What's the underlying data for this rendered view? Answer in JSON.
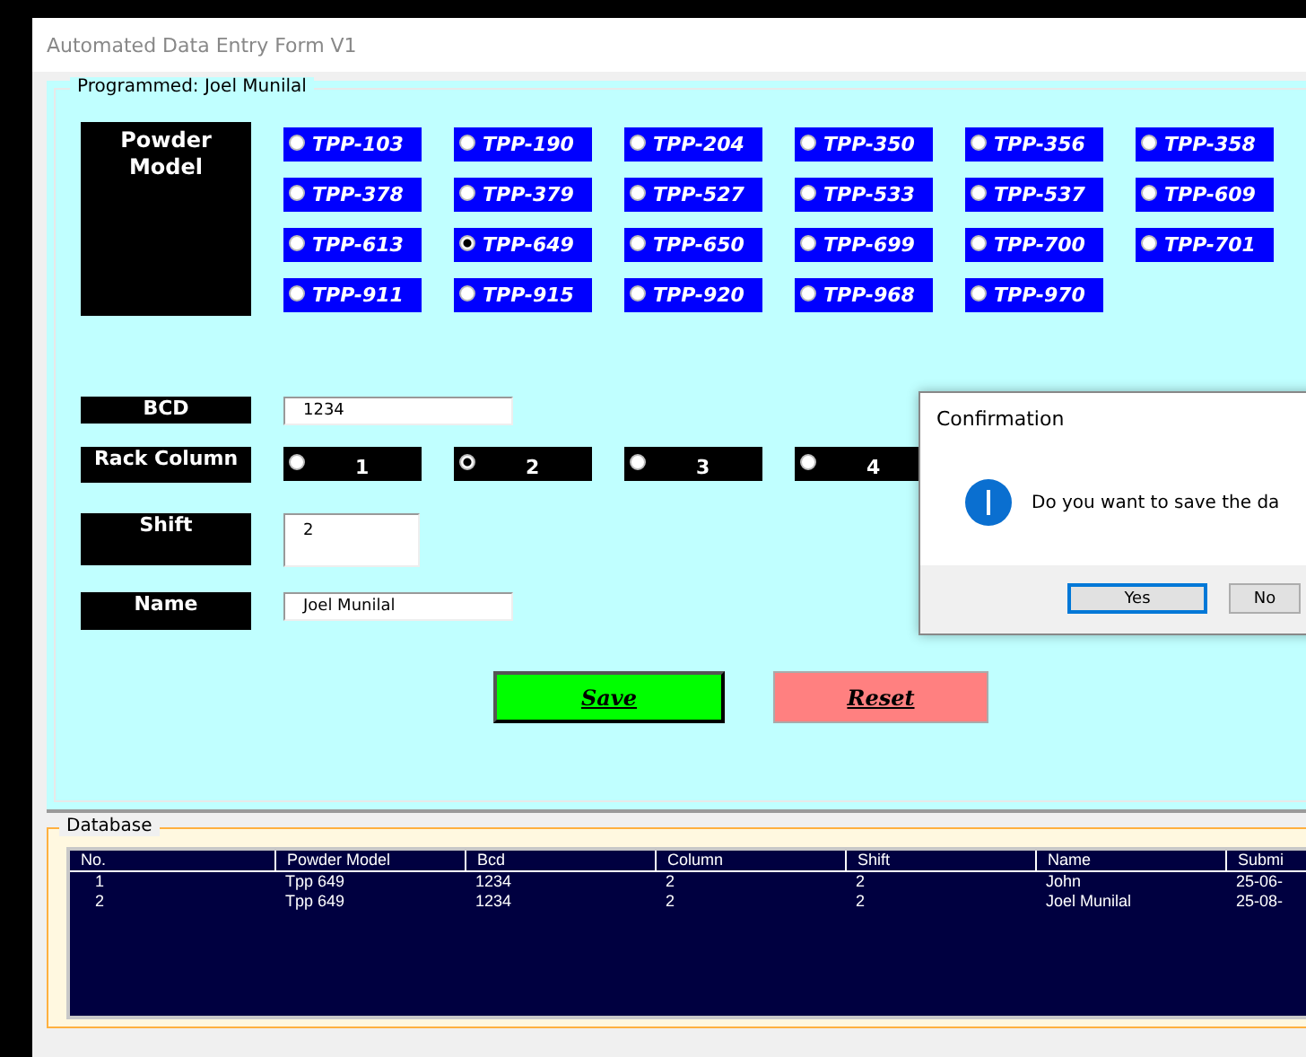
{
  "window": {
    "title": "Automated Data Entry Form V1"
  },
  "form": {
    "group_title": "Programmed: Joel Munilal",
    "powder_model": {
      "label": "Powder Model",
      "options": [
        {
          "label": "TPP-103",
          "selected": false
        },
        {
          "label": "TPP-190",
          "selected": false
        },
        {
          "label": "TPP-204",
          "selected": false
        },
        {
          "label": "TPP-350",
          "selected": false
        },
        {
          "label": "TPP-356",
          "selected": false
        },
        {
          "label": "TPP-358",
          "selected": false
        },
        {
          "label": "TPP-378",
          "selected": false
        },
        {
          "label": "TPP-379",
          "selected": false
        },
        {
          "label": "TPP-527",
          "selected": false
        },
        {
          "label": "TPP-533",
          "selected": false
        },
        {
          "label": "TPP-537",
          "selected": false
        },
        {
          "label": "TPP-609",
          "selected": false
        },
        {
          "label": "TPP-613",
          "selected": false
        },
        {
          "label": "TPP-649",
          "selected": true
        },
        {
          "label": "TPP-650",
          "selected": false
        },
        {
          "label": "TPP-699",
          "selected": false
        },
        {
          "label": "TPP-700",
          "selected": false
        },
        {
          "label": "TPP-701",
          "selected": false
        },
        {
          "label": "TPP-911",
          "selected": false
        },
        {
          "label": "TPP-915",
          "selected": false
        },
        {
          "label": "TPP-920",
          "selected": false
        },
        {
          "label": "TPP-968",
          "selected": false
        },
        {
          "label": "TPP-970",
          "selected": false
        }
      ]
    },
    "bcd": {
      "label": "BCD",
      "value": "1234"
    },
    "rack_column": {
      "label": "Rack Column",
      "options": [
        {
          "label": "1",
          "selected": false
        },
        {
          "label": "2",
          "selected": true
        },
        {
          "label": "3",
          "selected": false
        },
        {
          "label": "4",
          "selected": false
        }
      ]
    },
    "shift": {
      "label": "Shift",
      "value": "2"
    },
    "name": {
      "label": "Name",
      "value": "Joel Munilal"
    },
    "buttons": [
      {
        "label": "Save",
        "kind": "save"
      },
      {
        "label": "Reset",
        "kind": "reset"
      }
    ]
  },
  "database": {
    "title": "Database",
    "columns": [
      "No.",
      "Powder Model",
      "Bcd",
      "Column",
      "Shift",
      "Name",
      "Submi"
    ],
    "rows": [
      [
        "1",
        "Tpp 649",
        "1234",
        "2",
        "2",
        "John",
        "25-06-"
      ],
      [
        "2",
        "Tpp 649",
        "1234",
        "2",
        "2",
        "Joel Munilal",
        "25-08-"
      ]
    ]
  },
  "dialog": {
    "title": "Confirmation",
    "message": "Do you want to save the da",
    "buttons": [
      {
        "label": "Yes",
        "selected": true
      },
      {
        "label": "No",
        "selected": false
      }
    ]
  }
}
